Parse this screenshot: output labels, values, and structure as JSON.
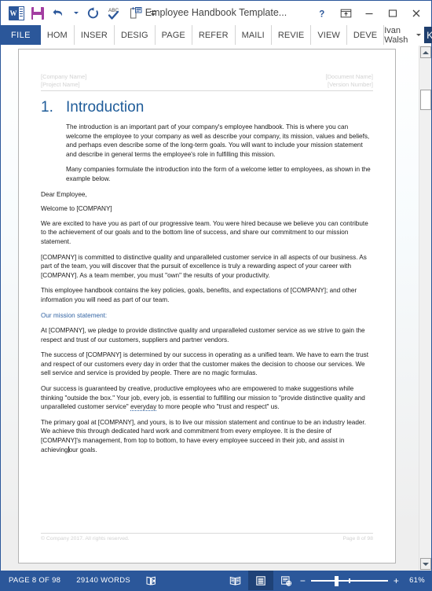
{
  "window": {
    "title": "Employee Handbook Template...",
    "quick_access": [
      {
        "name": "word-app-icon",
        "label": "W"
      },
      {
        "name": "save-icon",
        "label": "Save"
      },
      {
        "name": "undo-icon",
        "label": "Undo"
      },
      {
        "name": "undo-dropdown-icon",
        "label": "Undo options"
      },
      {
        "name": "redo-icon",
        "label": "Repeat"
      },
      {
        "name": "spelling-icon",
        "label": "ABC"
      },
      {
        "name": "print-preview-icon",
        "label": "Print Preview"
      },
      {
        "name": "customize-qat-icon",
        "label": "Customize Quick Access Toolbar"
      }
    ],
    "controls": {
      "help": "?",
      "ribbon_display": "Ribbon Display Options",
      "minimize": "Minimize",
      "maximize": "Maximize",
      "close": "Close"
    }
  },
  "ribbon": {
    "file_tab": "FILE",
    "tabs": [
      "HOM",
      "INSER",
      "DESIG",
      "PAGE",
      "REFER",
      "MAILI",
      "REVIE",
      "VIEW",
      "DEVE"
    ],
    "user": {
      "name": "Ivan Walsh",
      "avatar_initial": "K"
    }
  },
  "document": {
    "header": {
      "left_line1": "[Company Name]",
      "left_line2": "[Project Name]",
      "right_line1": "[Document Name]",
      "right_line2": "[Version Number]"
    },
    "heading": {
      "number": "1.",
      "text": "Introduction"
    },
    "paragraphs": [
      "The introduction is an important part of your company's employee handbook. This is where you can welcome the employee to your company as well as describe your company, its mission, values and beliefs, and perhaps even describe some of the long-term goals. You will want to include your mission statement and describe in general terms the employee's role in fulfilling this mission.",
      "Many companies formulate the introduction into the form of a welcome letter to employees, as shown in the example below."
    ],
    "letter": {
      "salutation": "Dear Employee,",
      "welcome": "Welcome to [COMPANY]",
      "paragraphs": [
        "We are excited to have you as part of our progressive team. You were hired because we believe you can contribute to the achievement of our goals and to the bottom line of success, and share our commitment to our mission statement.",
        "[COMPANY] is committed to distinctive quality and unparalleled customer service in all aspects of our business. As part of the team, you will discover that the pursuit of excellence is truly a rewarding aspect of your career with [COMPANY]. As a team member, you must \"own\" the results of your productivity.",
        "This employee handbook contains the key policies, goals, benefits, and expectations of [COMPANY]; and other information you will need as part of our team."
      ],
      "mission_label": "Our mission statement:",
      "mission_paragraphs": [
        "At [COMPANY], we pledge to provide distinctive quality and unparalleled customer service as we strive to gain the respect and trust of our customers, suppliers and partner vendors.",
        "The success of [COMPANY] is determined by our success in operating as a unified team. We have to earn the trust and respect of our customers every day in order that the customer makes the decision to choose our services. We sell service and service is provided by people. There are no magic formulas."
      ],
      "success_para_a": "Our success is guaranteed by creative, productive employees who are empowered to make suggestions while thinking \"outside the box.\" Your job, every job, is essential to fulfilling our mission to \"provide distinctive quality and unparalleled customer service\" ",
      "success_misspelled": "everyday",
      "success_para_b": " to more people who \"trust and respect\" us.",
      "final_para_a": "The primary goal at [COMPANY], and yours, is to live our mission statement and continue to be an industry leader. We achieve this through dedicated hard work and commitment from every employee. It is the desire of [COMPANY]'s management, from top to bottom, to have every employee succeed in their job, and assist in achieving",
      "final_para_b": "our goals."
    },
    "footer": {
      "left": "© Company 2017. All rights reserved.",
      "right": "Page 8 of 98"
    }
  },
  "status_bar": {
    "page_info": "PAGE 8 OF 98",
    "word_count": "29140 WORDS",
    "proofing_icon": "proofing-errors-icon",
    "views": [
      {
        "name": "read-mode-icon",
        "active": false
      },
      {
        "name": "print-layout-icon",
        "active": true
      },
      {
        "name": "web-layout-icon",
        "active": false
      }
    ],
    "zoom_out": "−",
    "zoom_in": "+",
    "zoom_level": "61%"
  },
  "colors": {
    "brand_blue": "#2b579a",
    "heading_blue": "#1f5c99",
    "accent_purple": "#a33ea1",
    "avatar_navy": "#1f3f6e"
  }
}
